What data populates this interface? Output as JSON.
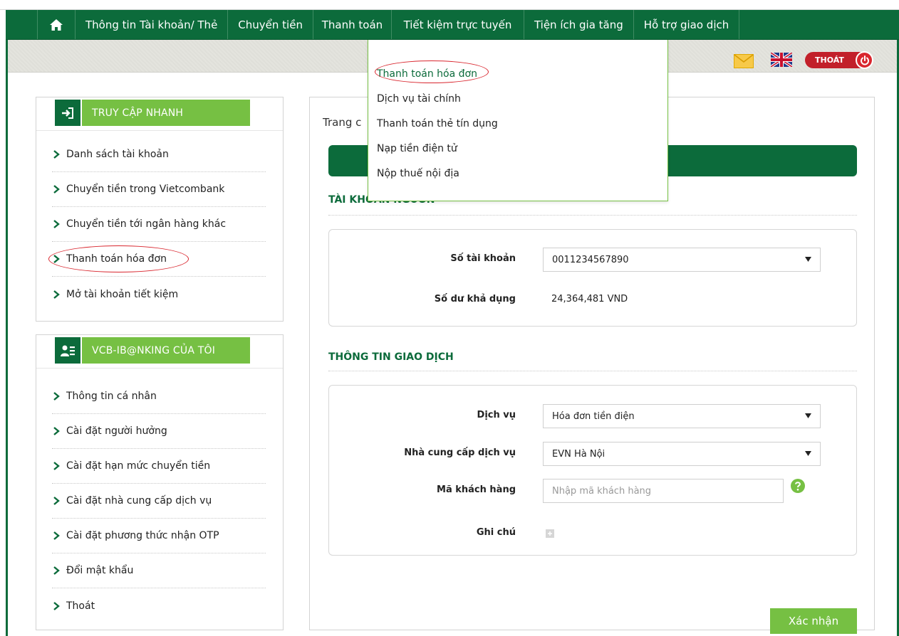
{
  "nav": {
    "items": [
      {
        "label": "Thông tin Tài khoản/ Thẻ"
      },
      {
        "label": "Chuyển tiền"
      },
      {
        "label": "Thanh toán"
      },
      {
        "label": "Tiết kiệm trực tuyến"
      },
      {
        "label": "Tiện ích gia tăng"
      },
      {
        "label": "Hỗ trợ giao dịch"
      }
    ]
  },
  "toolbar": {
    "logout_label": "THOÁT"
  },
  "dropdown": {
    "items": [
      {
        "label": "Thanh toán hóa đơn"
      },
      {
        "label": "Dịch vụ tài chính"
      },
      {
        "label": "Thanh toán thẻ tín dụng"
      },
      {
        "label": "Nạp tiền điện tử"
      },
      {
        "label": "Nộp thuế nội địa"
      }
    ]
  },
  "quick_access": {
    "title": "TRUY CẬP NHANH",
    "items": [
      {
        "label": "Danh sách tài khoản"
      },
      {
        "label": "Chuyển tiền trong Vietcombank"
      },
      {
        "label": "Chuyển tiền tới ngân hàng khác"
      },
      {
        "label": "Thanh toán hóa đơn"
      },
      {
        "label": "Mở tài khoản tiết kiệm"
      }
    ]
  },
  "my_banking": {
    "title": "VCB-IB@NKING CỦA TÔI",
    "items": [
      {
        "label": "Thông tin cá nhân"
      },
      {
        "label": "Cài đặt người hưởng"
      },
      {
        "label": "Cài đặt hạn mức chuyển tiền"
      },
      {
        "label": "Cài đặt nhà cung cấp dịch vụ"
      },
      {
        "label": "Cài đặt phương thức nhận OTP"
      },
      {
        "label": "Đổi mật khẩu"
      },
      {
        "label": "Thoát"
      }
    ]
  },
  "main": {
    "breadcrumb": "Trang c",
    "source_section": "TÀI KHOẢN NGUỒN",
    "account_label": "Số tài khoản",
    "account_value": "0011234567890",
    "balance_label": "Số dư khả dụng",
    "balance_value": "24,364,481 VND",
    "transaction_section": "THÔNG TIN GIAO DỊCH",
    "service_label": "Dịch vụ",
    "service_value": "Hóa đơn tiền điện",
    "provider_label": "Nhà cung cấp dịch vụ",
    "provider_value": "EVN Hà Nội",
    "customer_label": "Mã khách hàng",
    "customer_placeholder": "Nhập mã khách hàng",
    "note_label": "Ghi chú",
    "confirm_label": "Xác nhận"
  }
}
